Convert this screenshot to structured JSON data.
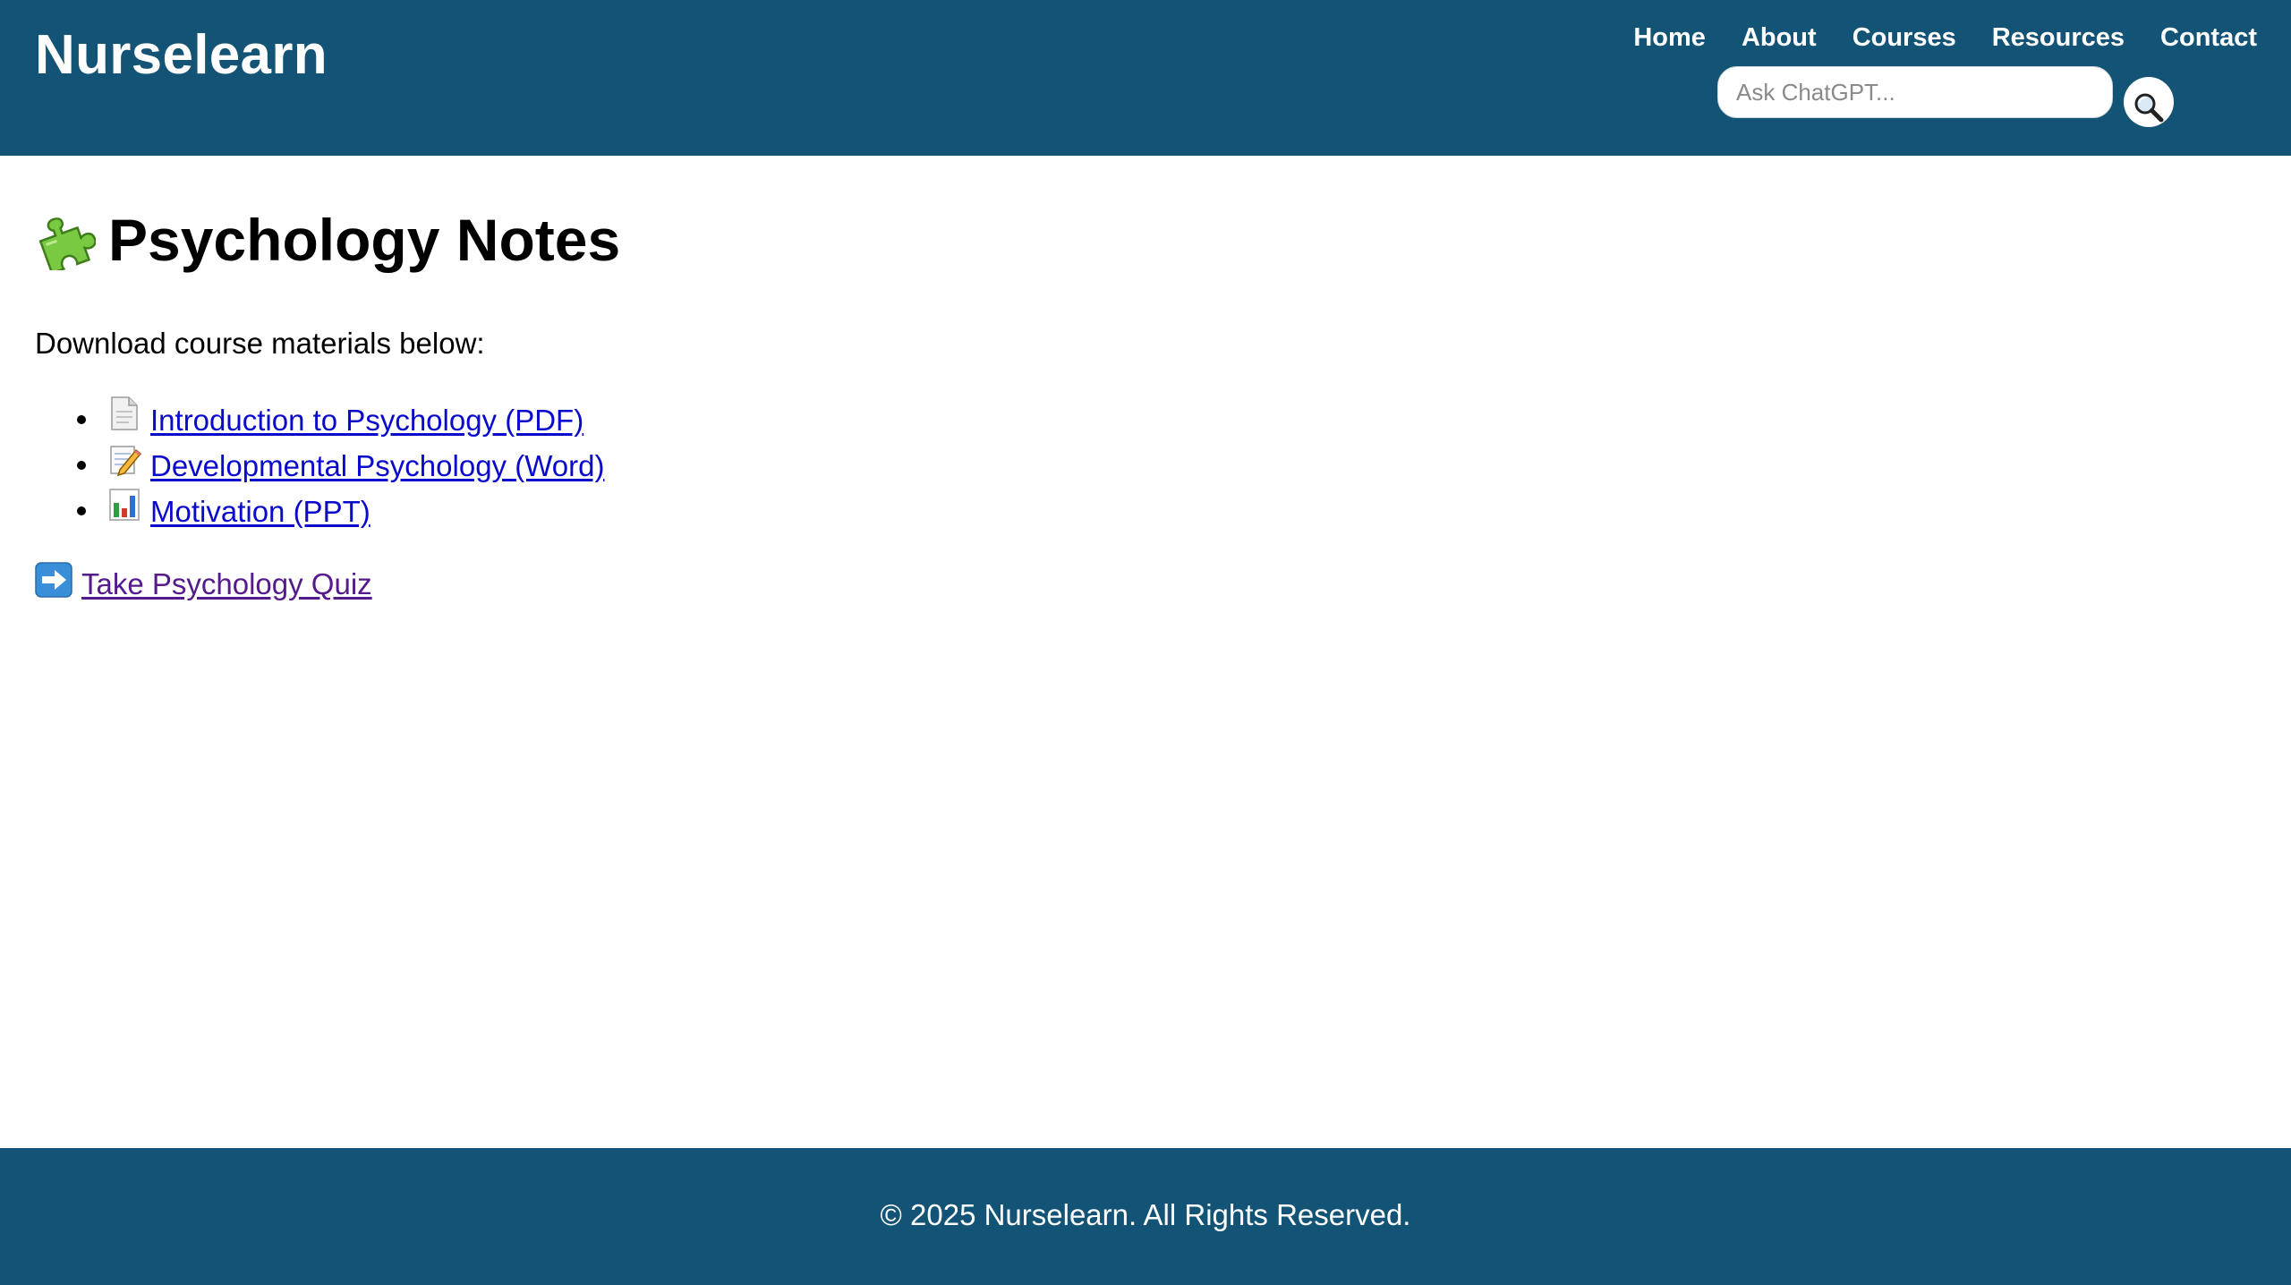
{
  "header": {
    "brand": "Nurselearn",
    "nav": [
      {
        "label": "Home"
      },
      {
        "label": "About"
      },
      {
        "label": "Courses"
      },
      {
        "label": "Resources"
      },
      {
        "label": "Contact"
      }
    ],
    "search": {
      "placeholder": "Ask ChatGPT...",
      "value": "",
      "button_icon": "magnifying-glass-icon"
    },
    "background_color": "#135476"
  },
  "main": {
    "title_icon": "puzzle-piece-icon",
    "title": "Psychology Notes",
    "intro": "Download course materials below:",
    "materials": [
      {
        "icon": "document-page-icon",
        "label": "Introduction to Psychology (PDF)"
      },
      {
        "icon": "memo-pencil-icon",
        "label": "Developmental Psychology (Word)"
      },
      {
        "icon": "bar-chart-icon",
        "label": "Motivation (PPT)"
      }
    ],
    "quiz": {
      "icon": "right-arrow-icon",
      "label": "Take Psychology Quiz"
    },
    "link_color": "#0a0acc",
    "visited_link_color": "#551a8b"
  },
  "footer": {
    "text": "© 2025 Nurselearn. All Rights Reserved.",
    "background_color": "#135476"
  }
}
